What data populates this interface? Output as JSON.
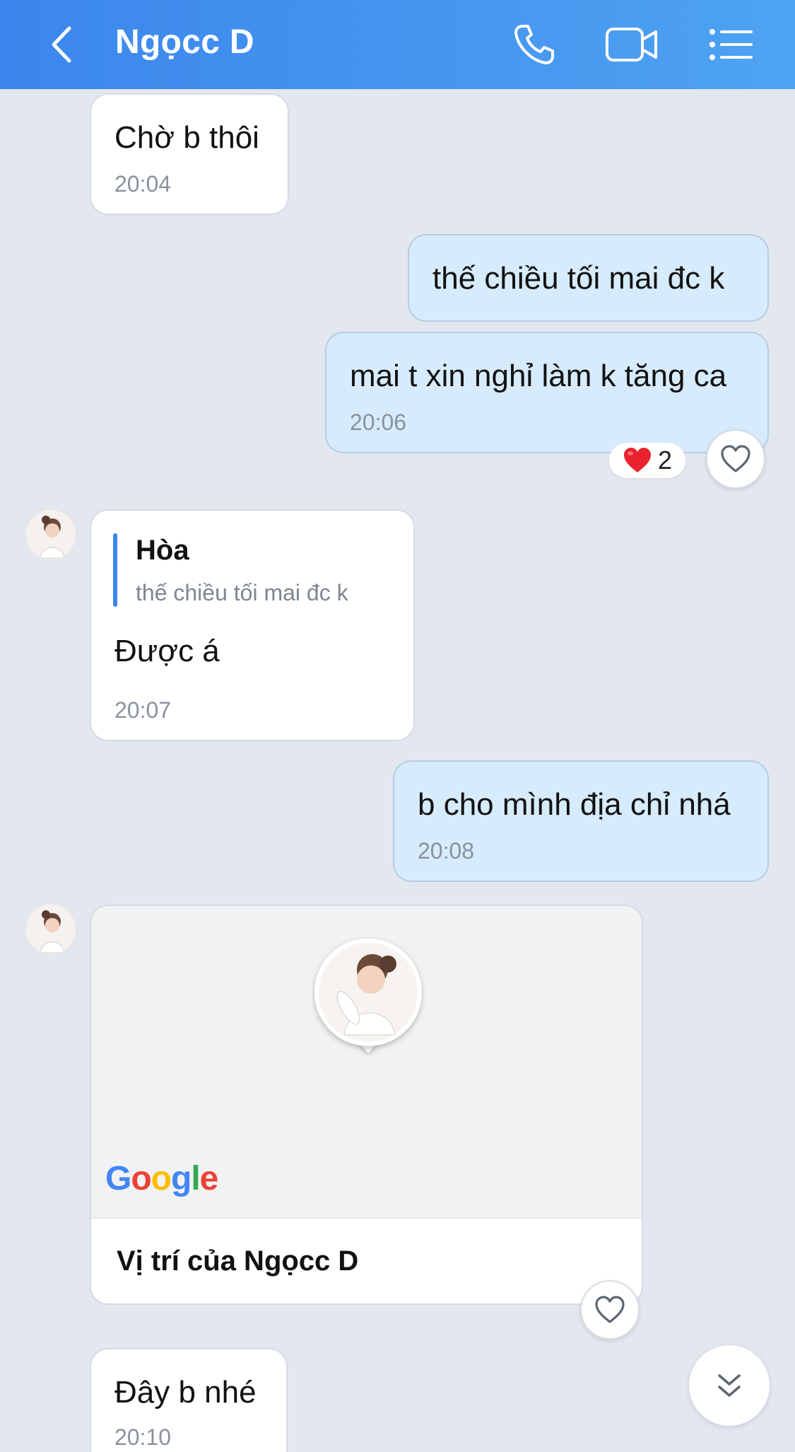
{
  "header": {
    "title": "Ngọcc D",
    "back_icon": "chevron-left-icon",
    "call_icon": "phone-icon",
    "video_icon": "video-camera-icon",
    "menu_icon": "list-menu-icon",
    "gradient_start": "#3b86ec",
    "gradient_end": "#4ea3f2"
  },
  "messages": [
    {
      "direction": "in",
      "text": "Chờ b thôi",
      "time": "20:04"
    },
    {
      "direction": "out",
      "text": "thế chiều tối mai đc k"
    },
    {
      "direction": "out",
      "text": "mai t xin nghỉ làm k tăng ca",
      "time": "20:06",
      "reaction": {
        "emoji": "❤️",
        "count": "2"
      }
    },
    {
      "direction": "in",
      "reply_to": {
        "author": "Hòa",
        "text": "thế chiều tối mai đc k"
      },
      "text": "Được á",
      "time": "20:07"
    },
    {
      "direction": "out",
      "text": "b cho mình địa chỉ nhá",
      "time": "20:08"
    },
    {
      "direction": "in",
      "type": "location",
      "map_provider": "Google",
      "title": "Vị trí của Ngọcc D"
    },
    {
      "direction": "in",
      "text": "Đây b nhé",
      "time": "20:10"
    }
  ],
  "colors": {
    "background": "#e3e8f0",
    "incoming_bubble": "#ffffff",
    "outgoing_bubble": "#d6ebfc",
    "quote_bar": "#3a86ef",
    "time_text": "#8a929c"
  },
  "scroll_down_icon": "double-chevron-down-icon"
}
